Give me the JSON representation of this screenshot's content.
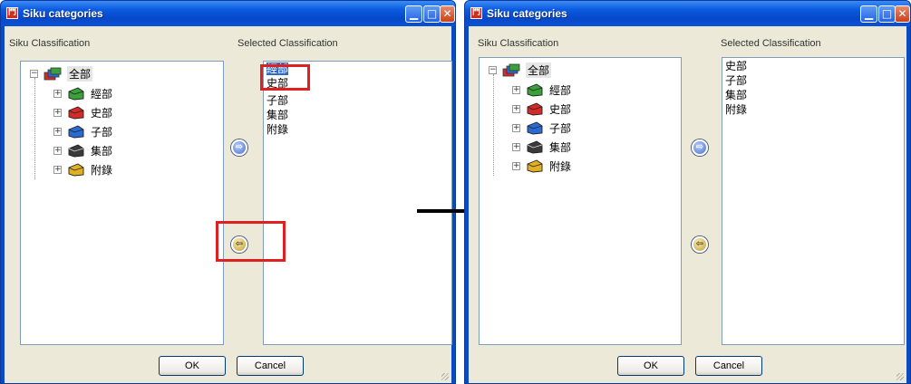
{
  "window_title": "Siku categories",
  "app_icon_char": "門",
  "titlebar_buttons": {
    "minimize": "▁",
    "maximize": "□",
    "close": "✕"
  },
  "labels": {
    "left": "Siku Classification",
    "right": "Selected Classification"
  },
  "tree": {
    "root": "全部",
    "children": [
      "經部",
      "史部",
      "子部",
      "集部",
      "附錄"
    ],
    "expander_root": "−",
    "expander_child": "+"
  },
  "before": {
    "selected": [
      "經部",
      "史部",
      "子部",
      "集部",
      "附錄"
    ],
    "highlighted_index": 0
  },
  "after": {
    "selected": [
      "史部",
      "子部",
      "集部",
      "附錄"
    ]
  },
  "buttons": {
    "ok": "OK",
    "cancel": "Cancel"
  },
  "arrow_buttons": {
    "add_glyph": "⇨",
    "remove_glyph": "⇦"
  },
  "colors": {
    "book_icons": [
      "#3aa03a",
      "#d42a2a",
      "#2a6ad4",
      "#2a2a2a",
      "#e0b020"
    ],
    "root_icon": "#8844aa",
    "annotation": "#e02020"
  }
}
